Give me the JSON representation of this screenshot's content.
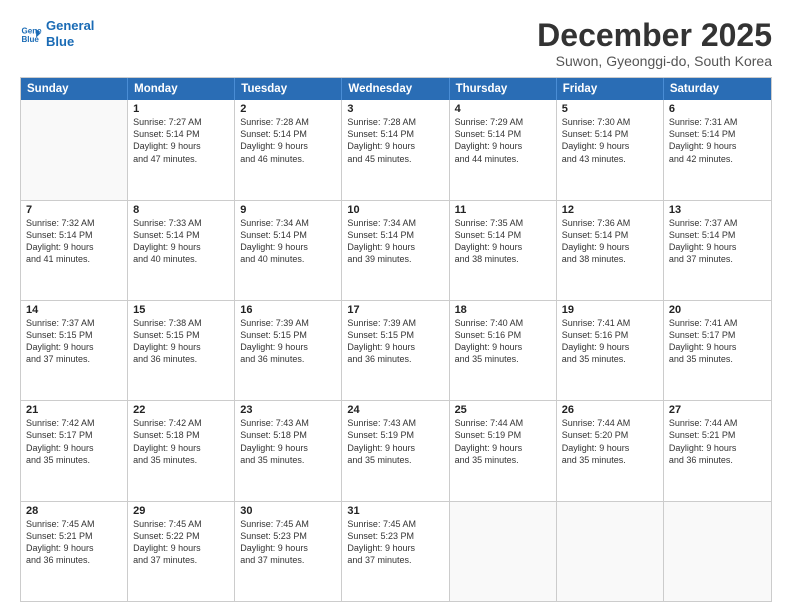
{
  "logo": {
    "line1": "General",
    "line2": "Blue"
  },
  "title": "December 2025",
  "subtitle": "Suwon, Gyeonggi-do, South Korea",
  "weekdays": [
    "Sunday",
    "Monday",
    "Tuesday",
    "Wednesday",
    "Thursday",
    "Friday",
    "Saturday"
  ],
  "weeks": [
    [
      {
        "day": "",
        "lines": []
      },
      {
        "day": "1",
        "lines": [
          "Sunrise: 7:27 AM",
          "Sunset: 5:14 PM",
          "Daylight: 9 hours",
          "and 47 minutes."
        ]
      },
      {
        "day": "2",
        "lines": [
          "Sunrise: 7:28 AM",
          "Sunset: 5:14 PM",
          "Daylight: 9 hours",
          "and 46 minutes."
        ]
      },
      {
        "day": "3",
        "lines": [
          "Sunrise: 7:28 AM",
          "Sunset: 5:14 PM",
          "Daylight: 9 hours",
          "and 45 minutes."
        ]
      },
      {
        "day": "4",
        "lines": [
          "Sunrise: 7:29 AM",
          "Sunset: 5:14 PM",
          "Daylight: 9 hours",
          "and 44 minutes."
        ]
      },
      {
        "day": "5",
        "lines": [
          "Sunrise: 7:30 AM",
          "Sunset: 5:14 PM",
          "Daylight: 9 hours",
          "and 43 minutes."
        ]
      },
      {
        "day": "6",
        "lines": [
          "Sunrise: 7:31 AM",
          "Sunset: 5:14 PM",
          "Daylight: 9 hours",
          "and 42 minutes."
        ]
      }
    ],
    [
      {
        "day": "7",
        "lines": [
          "Sunrise: 7:32 AM",
          "Sunset: 5:14 PM",
          "Daylight: 9 hours",
          "and 41 minutes."
        ]
      },
      {
        "day": "8",
        "lines": [
          "Sunrise: 7:33 AM",
          "Sunset: 5:14 PM",
          "Daylight: 9 hours",
          "and 40 minutes."
        ]
      },
      {
        "day": "9",
        "lines": [
          "Sunrise: 7:34 AM",
          "Sunset: 5:14 PM",
          "Daylight: 9 hours",
          "and 40 minutes."
        ]
      },
      {
        "day": "10",
        "lines": [
          "Sunrise: 7:34 AM",
          "Sunset: 5:14 PM",
          "Daylight: 9 hours",
          "and 39 minutes."
        ]
      },
      {
        "day": "11",
        "lines": [
          "Sunrise: 7:35 AM",
          "Sunset: 5:14 PM",
          "Daylight: 9 hours",
          "and 38 minutes."
        ]
      },
      {
        "day": "12",
        "lines": [
          "Sunrise: 7:36 AM",
          "Sunset: 5:14 PM",
          "Daylight: 9 hours",
          "and 38 minutes."
        ]
      },
      {
        "day": "13",
        "lines": [
          "Sunrise: 7:37 AM",
          "Sunset: 5:14 PM",
          "Daylight: 9 hours",
          "and 37 minutes."
        ]
      }
    ],
    [
      {
        "day": "14",
        "lines": [
          "Sunrise: 7:37 AM",
          "Sunset: 5:15 PM",
          "Daylight: 9 hours",
          "and 37 minutes."
        ]
      },
      {
        "day": "15",
        "lines": [
          "Sunrise: 7:38 AM",
          "Sunset: 5:15 PM",
          "Daylight: 9 hours",
          "and 36 minutes."
        ]
      },
      {
        "day": "16",
        "lines": [
          "Sunrise: 7:39 AM",
          "Sunset: 5:15 PM",
          "Daylight: 9 hours",
          "and 36 minutes."
        ]
      },
      {
        "day": "17",
        "lines": [
          "Sunrise: 7:39 AM",
          "Sunset: 5:15 PM",
          "Daylight: 9 hours",
          "and 36 minutes."
        ]
      },
      {
        "day": "18",
        "lines": [
          "Sunrise: 7:40 AM",
          "Sunset: 5:16 PM",
          "Daylight: 9 hours",
          "and 35 minutes."
        ]
      },
      {
        "day": "19",
        "lines": [
          "Sunrise: 7:41 AM",
          "Sunset: 5:16 PM",
          "Daylight: 9 hours",
          "and 35 minutes."
        ]
      },
      {
        "day": "20",
        "lines": [
          "Sunrise: 7:41 AM",
          "Sunset: 5:17 PM",
          "Daylight: 9 hours",
          "and 35 minutes."
        ]
      }
    ],
    [
      {
        "day": "21",
        "lines": [
          "Sunrise: 7:42 AM",
          "Sunset: 5:17 PM",
          "Daylight: 9 hours",
          "and 35 minutes."
        ]
      },
      {
        "day": "22",
        "lines": [
          "Sunrise: 7:42 AM",
          "Sunset: 5:18 PM",
          "Daylight: 9 hours",
          "and 35 minutes."
        ]
      },
      {
        "day": "23",
        "lines": [
          "Sunrise: 7:43 AM",
          "Sunset: 5:18 PM",
          "Daylight: 9 hours",
          "and 35 minutes."
        ]
      },
      {
        "day": "24",
        "lines": [
          "Sunrise: 7:43 AM",
          "Sunset: 5:19 PM",
          "Daylight: 9 hours",
          "and 35 minutes."
        ]
      },
      {
        "day": "25",
        "lines": [
          "Sunrise: 7:44 AM",
          "Sunset: 5:19 PM",
          "Daylight: 9 hours",
          "and 35 minutes."
        ]
      },
      {
        "day": "26",
        "lines": [
          "Sunrise: 7:44 AM",
          "Sunset: 5:20 PM",
          "Daylight: 9 hours",
          "and 35 minutes."
        ]
      },
      {
        "day": "27",
        "lines": [
          "Sunrise: 7:44 AM",
          "Sunset: 5:21 PM",
          "Daylight: 9 hours",
          "and 36 minutes."
        ]
      }
    ],
    [
      {
        "day": "28",
        "lines": [
          "Sunrise: 7:45 AM",
          "Sunset: 5:21 PM",
          "Daylight: 9 hours",
          "and 36 minutes."
        ]
      },
      {
        "day": "29",
        "lines": [
          "Sunrise: 7:45 AM",
          "Sunset: 5:22 PM",
          "Daylight: 9 hours",
          "and 37 minutes."
        ]
      },
      {
        "day": "30",
        "lines": [
          "Sunrise: 7:45 AM",
          "Sunset: 5:23 PM",
          "Daylight: 9 hours",
          "and 37 minutes."
        ]
      },
      {
        "day": "31",
        "lines": [
          "Sunrise: 7:45 AM",
          "Sunset: 5:23 PM",
          "Daylight: 9 hours",
          "and 37 minutes."
        ]
      },
      {
        "day": "",
        "lines": []
      },
      {
        "day": "",
        "lines": []
      },
      {
        "day": "",
        "lines": []
      }
    ]
  ]
}
